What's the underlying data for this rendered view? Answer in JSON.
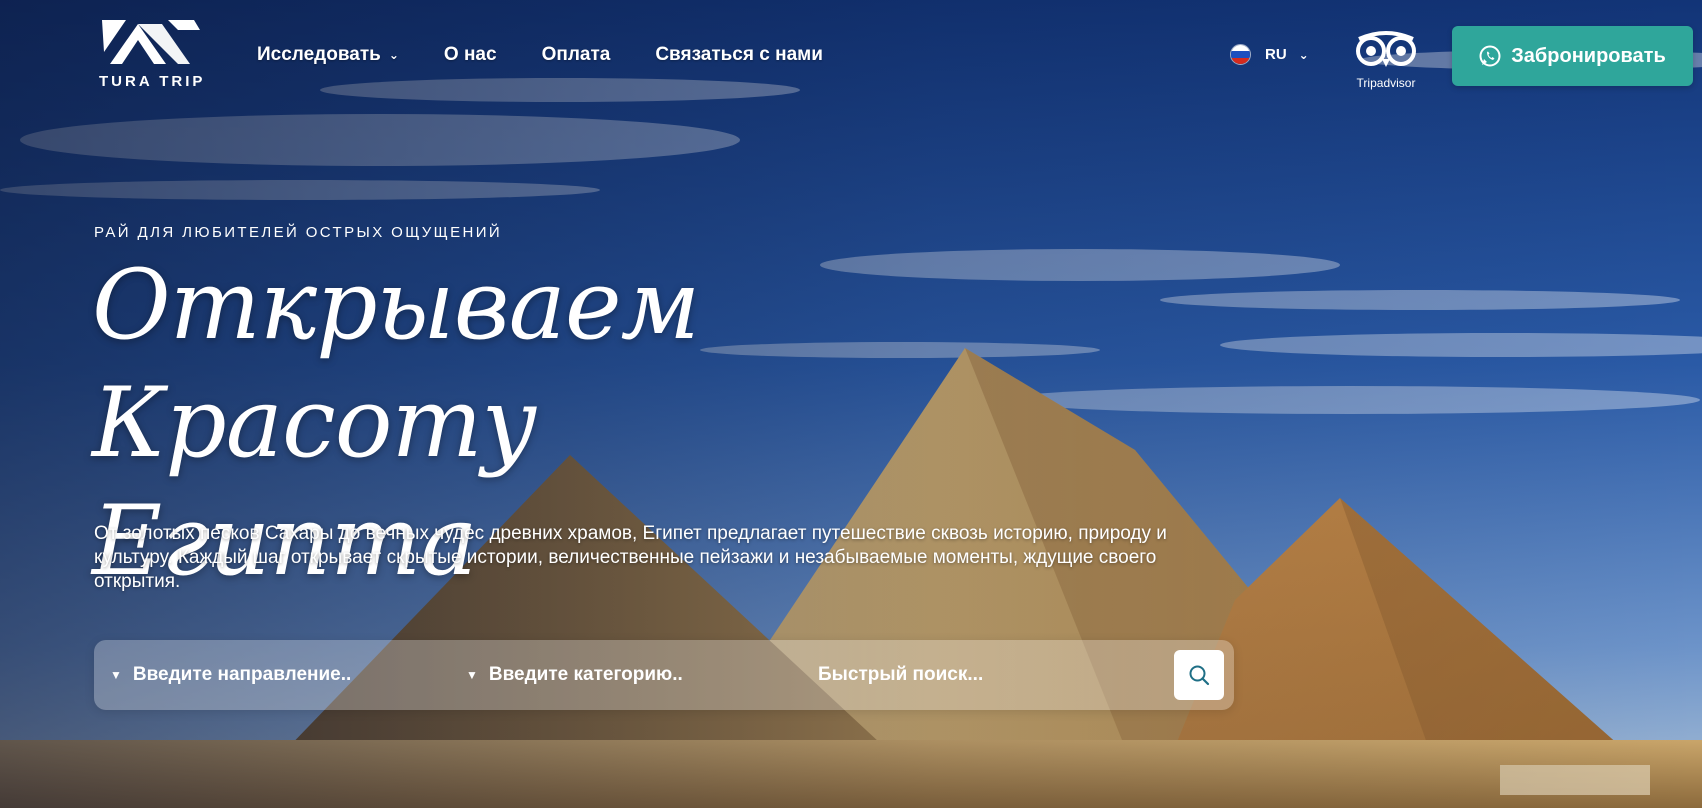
{
  "header": {
    "logo_text": "TURA TRIP",
    "nav": [
      {
        "label": "Исследовать",
        "has_dropdown": true
      },
      {
        "label": "О нас"
      },
      {
        "label": "Оплата"
      },
      {
        "label": "Связаться с нами"
      }
    ],
    "language": {
      "code": "RU",
      "flag": "russia-flag-icon"
    },
    "tripadvisor_label": "Tripadvisor",
    "book_button": {
      "label": "Забронировать",
      "icon": "whatsapp-icon",
      "color": "#2fa69b"
    }
  },
  "hero": {
    "eyebrow": "Рай для любителей острых ощущений",
    "headline_line1": "Открываем",
    "headline_line2": "Красоту Египта",
    "description": "От золотых песков Сахары до вечных чудес древних храмов, Египет предлагает путешествие сквозь историю, природу и культуру. Каждый шаг открывает скрытые истории, величественные пейзажи и незабываемые моменты, ждущие своего открытия."
  },
  "search": {
    "destination_placeholder": "Введите направление..",
    "category_placeholder": "Введите категорию..",
    "quick_search_placeholder": "Быстрый поиск...",
    "button_icon": "search-icon"
  },
  "colors": {
    "accent": "#2fa69b",
    "sky_top": "#163a7c",
    "sand": "#c9a160"
  }
}
